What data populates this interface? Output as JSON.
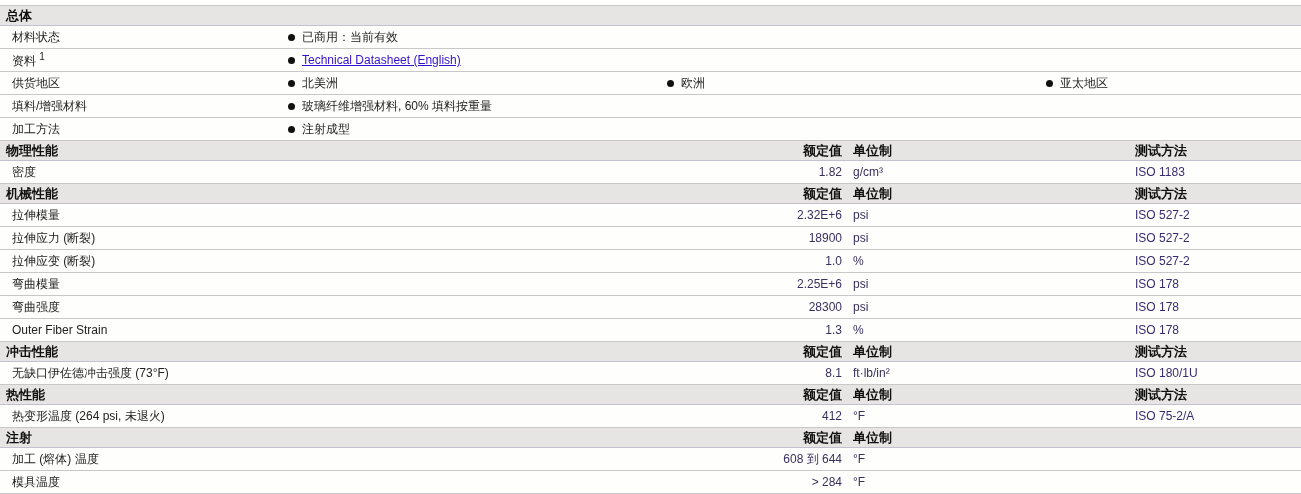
{
  "sections": [
    {
      "title": "总体",
      "kind": "general",
      "rows": [
        {
          "label": "材料状态",
          "entries": [
            {
              "kind": "text",
              "text": "已商用：当前有效"
            }
          ]
        },
        {
          "label": "资料 $^{1}$",
          "entries": [
            {
              "kind": "link",
              "text": "Technical Datasheet (English)"
            }
          ]
        },
        {
          "label": "供货地区",
          "entries": [
            {
              "kind": "text",
              "text": "北美洲"
            },
            {
              "kind": "text",
              "text": "欧洲"
            },
            {
              "kind": "text",
              "text": "亚太地区"
            }
          ]
        },
        {
          "label": "填料/增强材料",
          "entries": [
            {
              "kind": "text",
              "text": "玻璃纤维增强材料, 60% 填料按重量"
            }
          ]
        },
        {
          "label": "加工方法",
          "entries": [
            {
              "kind": "text",
              "text": "注射成型"
            }
          ]
        }
      ]
    },
    {
      "title": "物理性能",
      "kind": "property",
      "columns": [
        "额定值",
        "单位制",
        "测试方法"
      ],
      "rows": [
        {
          "label": "密度",
          "value": "1.82",
          "unit": "g/cm³",
          "method": "ISO 1183"
        }
      ]
    },
    {
      "title": "机械性能",
      "kind": "property",
      "columns": [
        "额定值",
        "单位制",
        "测试方法"
      ],
      "rows": [
        {
          "label": "拉伸模量",
          "value": "2.32E+6",
          "unit": "psi",
          "method": "ISO 527-2"
        },
        {
          "label": "拉伸应力 (断裂)",
          "value": "18900",
          "unit": "psi",
          "method": "ISO 527-2"
        },
        {
          "label": "拉伸应变 (断裂)",
          "value": "1.0",
          "unit": "%",
          "method": "ISO 527-2"
        },
        {
          "label": "弯曲模量",
          "value": "2.25E+6",
          "unit": "psi",
          "method": "ISO 178"
        },
        {
          "label": "弯曲强度",
          "value": "28300",
          "unit": "psi",
          "method": "ISO 178"
        },
        {
          "label": "Outer Fiber Strain",
          "value": "1.3",
          "unit": "%",
          "method": "ISO 178"
        }
      ]
    },
    {
      "title": "冲击性能",
      "kind": "property",
      "columns": [
        "额定值",
        "单位制",
        "测试方法"
      ],
      "rows": [
        {
          "label": "无缺口伊佐德冲击强度 (73°F)",
          "value": "8.1",
          "unit": "ft·lb/in²",
          "method": "ISO 180/1U"
        }
      ]
    },
    {
      "title": "热性能",
      "kind": "property",
      "columns": [
        "额定值",
        "单位制",
        "测试方法"
      ],
      "rows": [
        {
          "label": "热变形温度 (264 psi, 未退火)",
          "value": "412",
          "unit": "°F",
          "method": "ISO 75-2/A"
        }
      ]
    },
    {
      "title": "注射",
      "kind": "property",
      "columns": [
        "额定值",
        "单位制"
      ],
      "rows": [
        {
          "label": "加工 (熔体) 温度",
          "value": "608 到 644",
          "unit": "°F"
        },
        {
          "label": "模具温度",
          "value": "> 284",
          "unit": "°F"
        }
      ]
    }
  ]
}
